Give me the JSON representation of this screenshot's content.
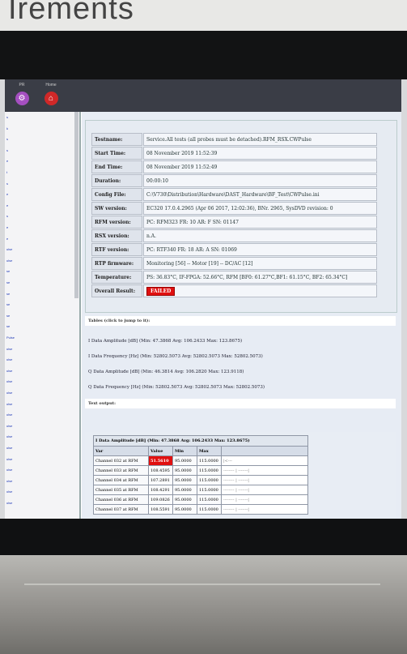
{
  "backdrop": {
    "brand": "Irements"
  },
  "toolbar": {
    "buttons": [
      {
        "label": "PR",
        "icon": "settings-icon",
        "color": "#a54fc0"
      },
      {
        "label": "Home",
        "icon": "home-icon",
        "color": "#d02828"
      }
    ]
  },
  "sidebar": {
    "items": [
      "s",
      "k",
      "s",
      "s",
      "e",
      "t",
      "s",
      "e",
      "e",
      "s",
      "e",
      "e",
      "ulse",
      "ulse",
      "se",
      "se",
      "se",
      "se",
      "se",
      "se",
      "Pulse",
      "ulse",
      "ulse",
      "ulse",
      "ulse",
      "ulse",
      "ulse",
      "ulse",
      "ulse",
      "ulse",
      "ulse",
      "ulse",
      "ulse",
      "ulse",
      "ulse",
      "ulse"
    ]
  },
  "info": {
    "rows": [
      {
        "key": "Testname:",
        "value": "Service.All tests (all probes must be detached).RFM_RSX.CWPulse"
      },
      {
        "key": "Start Time:",
        "value": "08 November 2019 11:52:39"
      },
      {
        "key": "End Time:",
        "value": "08 November 2019 11:52:49"
      },
      {
        "key": "Duration:",
        "value": "00:00:10"
      },
      {
        "key": "Config File:",
        "value": "C:\\V730\\Distribution\\Hardware\\DAST_Hardware\\BF_Test\\CWPulse.ini"
      },
      {
        "key": "SW version:",
        "value": "EC320 17.0.4.2965 (Apr 06 2017, 12:02:36), BNr. 2965, SysDVD revision: 0"
      },
      {
        "key": "RFM version:",
        "value": "PC: RFM323 FR: 10 AR: F SN: 01147"
      },
      {
        "key": "RSX version:",
        "value": "n.A."
      },
      {
        "key": "RTF version:",
        "value": "PC: RTF340 FR: 18 AR: A SN: 01069"
      },
      {
        "key": "RTP firmware:",
        "value": "Monitoring [56] -- Motor [19] -- DC/AC [12]"
      },
      {
        "key": "Temperature:",
        "value": "PS: 36.83°C, IF-FPGA: 52.66°C, RFM [BF0: 61.27°C,BF1: 61.15°C, BF2: 65.34°C]"
      },
      {
        "key": "Overall Result:",
        "value": "FAILED"
      }
    ]
  },
  "tables_section": {
    "heading": "Tables (click to jump to it):",
    "links": [
      "I Data Amplitude [dB] (Min: 47.3868 Avg: 106.2433 Max: 123.8675)",
      "I Data Frequency [Hz] (Min: 52802.5073 Avg: 52802.5073 Max: 52802.5073)",
      "Q Data Amplitude [dB] (Min: 46.3814 Avg: 106.2820 Max: 123.9118)",
      "Q Data Frequency [Hz] (Min: 52802.5073 Avg: 52802.5073 Max: 52802.5073)"
    ]
  },
  "text_output": {
    "heading": "Text output:"
  },
  "data_table": {
    "caption": "I Data Amplitude [dB]  (Min: 47.3868 Avg: 106.2433 Max: 123.8675)",
    "headers": [
      "Var",
      "Value",
      "Min",
      "Max"
    ],
    "rows": [
      {
        "var": "Channel 032 at RFM",
        "value": "51.5610",
        "min": "95.0000",
        "max": "115.0000",
        "bar": "|<---",
        "fail": true
      },
      {
        "var": "Channel 033 at RFM",
        "value": "108.4595",
        "min": "95.0000",
        "max": "115.0000",
        "bar": "-------- | -------|",
        "fail": false
      },
      {
        "var": "Channel 034 at RFM",
        "value": "107.2891",
        "min": "95.0000",
        "max": "115.0000",
        "bar": "-------- | -------|",
        "fail": false
      },
      {
        "var": "Channel 035 at RFM",
        "value": "108.4291",
        "min": "95.0000",
        "max": "115.0000",
        "bar": "-------- | -------|",
        "fail": false
      },
      {
        "var": "Channel 036 at RFM",
        "value": "109.0826",
        "min": "95.0000",
        "max": "115.0000",
        "bar": "-------- | -------|",
        "fail": false
      },
      {
        "var": "Channel 037 at RFM",
        "value": "108.5591",
        "min": "95.0000",
        "max": "115.0000",
        "bar": "-------- | -------|",
        "fail": false
      }
    ]
  }
}
